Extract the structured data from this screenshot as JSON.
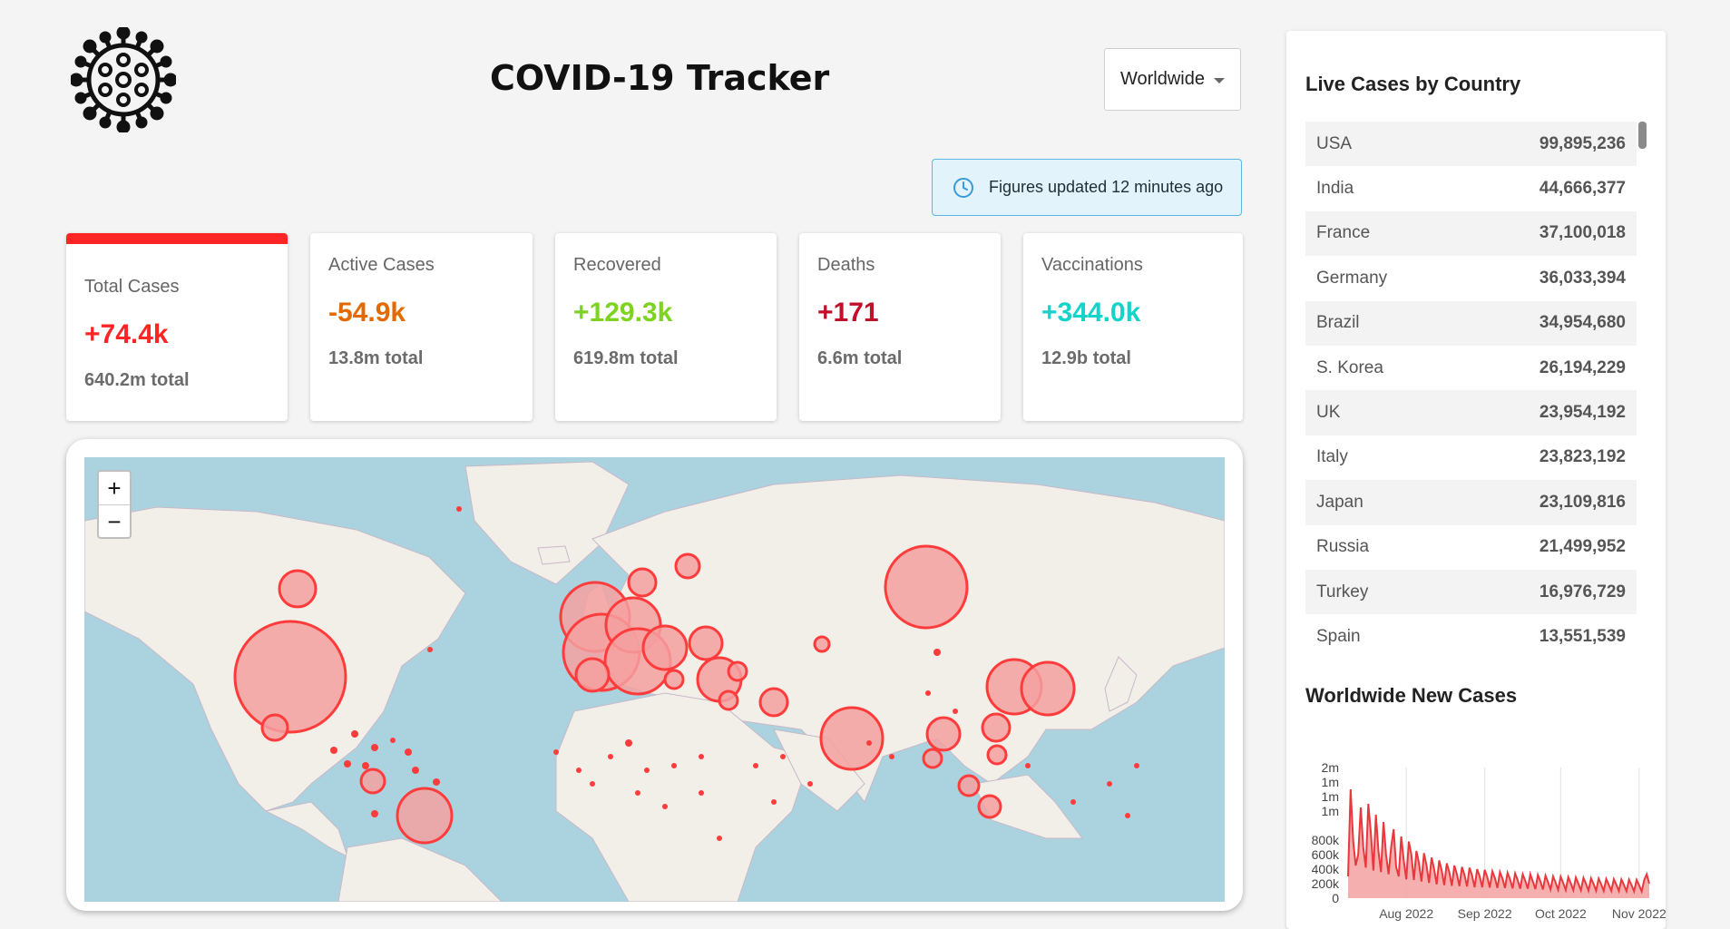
{
  "header": {
    "title": "COVID-19 Tracker",
    "country_select": "Worldwide",
    "update_notice": "Figures updated 12 minutes ago"
  },
  "colors": {
    "cases": "#ff2525",
    "active": "#e36a00",
    "recovered": "#7ed321",
    "deaths": "#c0102a",
    "vaccinations": "#14d3c8",
    "bubble_fill": "#f5a0a0",
    "bubble_stroke": "#ff3b3b"
  },
  "stats": [
    {
      "label": "Total Cases",
      "delta": "+74.4k",
      "total": "640.2m total",
      "color": "#ff2525"
    },
    {
      "label": "Active Cases",
      "delta": "-54.9k",
      "total": "13.8m total",
      "color": "#e36a00"
    },
    {
      "label": "Recovered",
      "delta": "+129.3k",
      "total": "619.8m total",
      "color": "#7ed321"
    },
    {
      "label": "Deaths",
      "delta": "+171",
      "total": "6.6m total",
      "color": "#c0102a"
    },
    {
      "label": "Vaccinations",
      "delta": "+344.0k",
      "total": "12.9b total",
      "color": "#14d3c8"
    }
  ],
  "map": {
    "zoom_in": "+",
    "zoom_out": "−"
  },
  "sidebar": {
    "live_title": "Live Cases by Country",
    "countries": [
      {
        "name": "USA",
        "cases": "99,895,236"
      },
      {
        "name": "India",
        "cases": "44,666,377"
      },
      {
        "name": "France",
        "cases": "37,100,018"
      },
      {
        "name": "Germany",
        "cases": "36,033,394"
      },
      {
        "name": "Brazil",
        "cases": "34,954,680"
      },
      {
        "name": "S. Korea",
        "cases": "26,194,229"
      },
      {
        "name": "UK",
        "cases": "23,954,192"
      },
      {
        "name": "Italy",
        "cases": "23,823,192"
      },
      {
        "name": "Japan",
        "cases": "23,109,816"
      },
      {
        "name": "Russia",
        "cases": "21,499,952"
      },
      {
        "name": "Turkey",
        "cases": "16,976,729"
      },
      {
        "name": "Spain",
        "cases": "13,551,539"
      }
    ],
    "chart_title": "Worldwide New Cases"
  },
  "chart_data": {
    "type": "area",
    "ytick_labels": [
      "2m",
      "1m",
      "1m",
      "1m",
      "800k",
      "600k",
      "400k",
      "200k",
      "0"
    ],
    "ytick_values": [
      1800000,
      1600000,
      1400000,
      1200000,
      800000,
      600000,
      400000,
      200000,
      0
    ],
    "xtick_labels": [
      "Aug 2022",
      "Sep 2022",
      "Oct 2022",
      "Nov 2022"
    ],
    "xtick_days": [
      23,
      54,
      84,
      115
    ],
    "ylim": [
      0,
      1800000
    ],
    "grid": "vertical",
    "series": [
      {
        "values": [
          300000,
          1500000,
          800000,
          450000,
          600000,
          1250000,
          700000,
          420000,
          1300000,
          900000,
          380000,
          1150000,
          650000,
          360000,
          1050000,
          600000,
          330000,
          700000,
          950000,
          430000,
          300000,
          850000,
          520000,
          260000,
          780000,
          600000,
          250000,
          650000,
          480000,
          230000,
          620000,
          450000,
          210000,
          560000,
          400000,
          190000,
          520000,
          380000,
          180000,
          480000,
          360000,
          170000,
          450000,
          330000,
          165000,
          430000,
          320000,
          160000,
          420000,
          310000,
          150000,
          400000,
          300000,
          150000,
          390000,
          290000,
          145000,
          370000,
          280000,
          140000,
          360000,
          270000,
          140000,
          350000,
          260000,
          135000,
          340000,
          250000,
          130000,
          330000,
          240000,
          130000,
          330000,
          230000,
          125000,
          320000,
          230000,
          120000,
          310000,
          220000,
          120000,
          300000,
          215000,
          115000,
          295000,
          210000,
          112000,
          290000,
          205000,
          110000,
          285000,
          200000,
          108000,
          280000,
          198000,
          105000,
          275000,
          195000,
          103000,
          270000,
          190000,
          100000,
          265000,
          188000,
          100000,
          262000,
          185000,
          98000,
          258000,
          182000,
          96000,
          255000,
          180000,
          95000,
          252000,
          178000,
          93000,
          250000,
          330000,
          200000
        ]
      }
    ]
  }
}
